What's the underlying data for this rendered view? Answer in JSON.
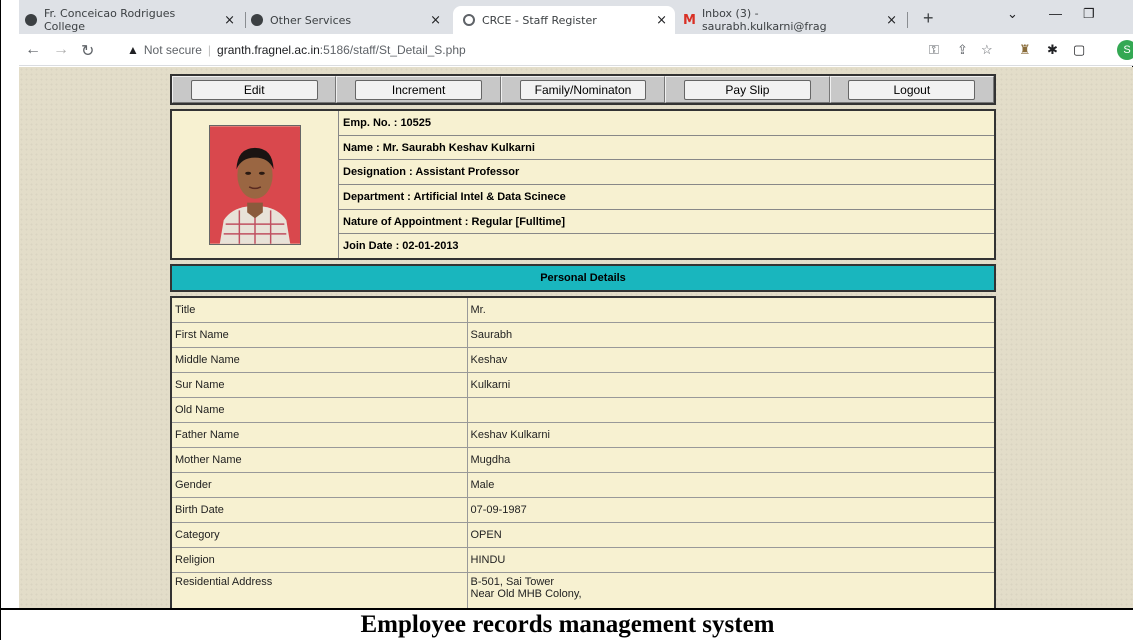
{
  "browser": {
    "tabs": [
      {
        "title": "Fr. Conceicao Rodrigues College",
        "favicon_color": "#3c4043"
      },
      {
        "title": "Other Services",
        "favicon_color": "#3c4043"
      },
      {
        "title": "CRCE - Staff Register",
        "favicon_color": "#5f6368"
      },
      {
        "title": "Inbox (3) - saurabh.kulkarni@frag",
        "favicon_color": "#d93025"
      }
    ],
    "new_tab": "+",
    "address": {
      "security_label": "Not secure",
      "host": "granth.fragnel.ac.in",
      "path": ":5186/staff/St_Detail_S.php"
    },
    "profile_initial": "S"
  },
  "toolbar": {
    "buttons": [
      "Edit",
      "Increment",
      "Family/Nominaton",
      "Pay Slip",
      "Logout"
    ]
  },
  "employee": {
    "emp_no": "Emp. No. : 10525",
    "name": "Name : Mr. Saurabh Keshav Kulkarni",
    "designation": "Designation : Assistant Professor",
    "department": "Department : Artificial Intel & Data Scinece",
    "appointment": "Nature of Appointment : Regular [Fulltime]",
    "join_date": "Join Date : 02-01-2013"
  },
  "personal": {
    "header": "Personal Details",
    "rows": [
      {
        "label": "Title",
        "value": "Mr."
      },
      {
        "label": "First Name",
        "value": "Saurabh"
      },
      {
        "label": "Middle Name",
        "value": "Keshav"
      },
      {
        "label": "Sur Name",
        "value": "Kulkarni"
      },
      {
        "label": "Old Name",
        "value": ""
      },
      {
        "label": "Father Name",
        "value": "Keshav Kulkarni"
      },
      {
        "label": "Mother Name",
        "value": "Mugdha"
      },
      {
        "label": "Gender",
        "value": "Male"
      },
      {
        "label": "Birth Date",
        "value": "07-09-1987"
      },
      {
        "label": "Category",
        "value": "OPEN"
      },
      {
        "label": "Religion",
        "value": "HINDU"
      }
    ],
    "address_label": "Residential Address",
    "address_lines": [
      "B-501, Sai Tower",
      "Near Old MHB Colony,"
    ]
  },
  "caption": "Employee records management system",
  "colors": {
    "page_bg": "#e3ddc9",
    "panel_bg": "#f7f1d1",
    "header_teal": "#19b6be"
  }
}
